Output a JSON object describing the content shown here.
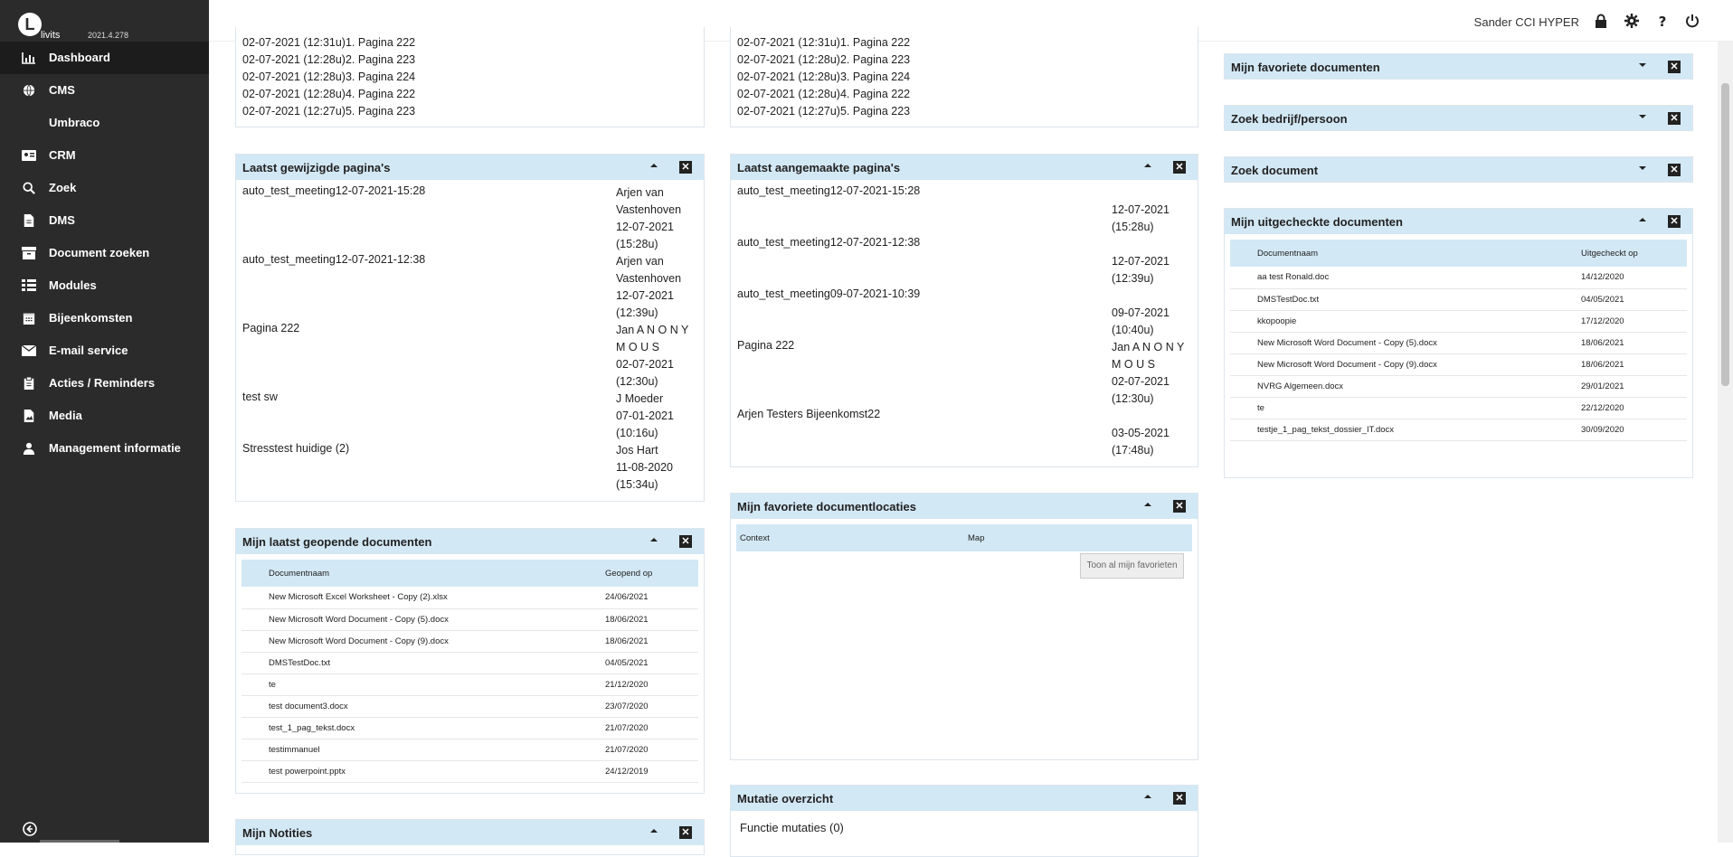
{
  "app": {
    "logo_letter": "L",
    "logo_name": "livits",
    "version": "2021.4.278"
  },
  "nav": [
    {
      "label": "Dashboard"
    },
    {
      "label": "CMS"
    },
    {
      "label": "Umbraco"
    },
    {
      "label": "CRM"
    },
    {
      "label": "Zoek"
    },
    {
      "label": "DMS"
    },
    {
      "label": "Document zoeken"
    },
    {
      "label": "Modules"
    },
    {
      "label": "Bijeenkomsten"
    },
    {
      "label": "E-mail service"
    },
    {
      "label": "Acties / Reminders"
    },
    {
      "label": "Media"
    },
    {
      "label": "Management informatie"
    }
  ],
  "header": {
    "user": "Sander CCI HYPER"
  },
  "recent_visited_1": [
    "02-07-2021 (12:31u)1. Pagina 222",
    "02-07-2021 (12:28u)2. Pagina 223",
    "02-07-2021 (12:28u)3. Pagina 224",
    "02-07-2021 (12:28u)4. Pagina 222",
    "02-07-2021 (12:27u)5. Pagina 223"
  ],
  "recent_visited_2": [
    "02-07-2021 (12:31u)1. Pagina 222",
    "02-07-2021 (12:28u)2. Pagina 223",
    "02-07-2021 (12:28u)3. Pagina 224",
    "02-07-2021 (12:28u)4. Pagina 222",
    "02-07-2021 (12:27u)5. Pagina 223"
  ],
  "changed_pages": {
    "title": "Laatst gewijzigde pagina's",
    "rows": [
      {
        "name": "auto_test_meeting12-07-2021-15:28",
        "meta": [
          "Arjen van",
          "Vastenhoven",
          "12-07-2021",
          "(15:28u)"
        ]
      },
      {
        "name": "auto_test_meeting12-07-2021-12:38",
        "meta": [
          "Arjen van",
          "Vastenhoven",
          "12-07-2021",
          "(12:39u)"
        ]
      },
      {
        "name": "Pagina 222",
        "meta": [
          "Jan A N O N Y",
          "M O U S",
          "02-07-2021",
          "(12:30u)"
        ]
      },
      {
        "name": "test sw",
        "meta": [
          "J Moeder",
          "07-01-2021",
          "(10:16u)"
        ]
      },
      {
        "name": "Stresstest huidige (2)",
        "meta": [
          "Jos Hart",
          "11-08-2020",
          "(15:34u)"
        ]
      }
    ]
  },
  "created_pages": {
    "title": "Laatst aangemaakte pagina's",
    "rows": [
      {
        "name": "auto_test_meeting12-07-2021-15:28",
        "meta": [
          "",
          "12-07-2021",
          "(15:28u)"
        ]
      },
      {
        "name": "auto_test_meeting12-07-2021-12:38",
        "meta": [
          "",
          "12-07-2021",
          "(12:39u)"
        ]
      },
      {
        "name": "auto_test_meeting09-07-2021-10:39",
        "meta": [
          "",
          "09-07-2021",
          "(10:40u)"
        ]
      },
      {
        "name": "Pagina 222",
        "meta": [
          "Jan A N O N Y",
          "M O U S",
          "02-07-2021",
          "(12:30u)"
        ]
      },
      {
        "name": "Arjen Testers Bijeenkomst22",
        "meta": [
          "",
          "03-05-2021",
          "(17:48u)"
        ]
      }
    ]
  },
  "opened_docs": {
    "title": "Mijn laatst geopende documenten",
    "columns": [
      "Documentnaam",
      "Geopend op"
    ],
    "rows": [
      [
        "New Microsoft Excel Worksheet - Copy (2).xlsx",
        "24/06/2021"
      ],
      [
        "New Microsoft Word Document - Copy (5).docx",
        "18/06/2021"
      ],
      [
        "New Microsoft Word Document - Copy (9).docx",
        "18/06/2021"
      ],
      [
        "DMSTestDoc.txt",
        "04/05/2021"
      ],
      [
        "te",
        "21/12/2020"
      ],
      [
        "test document3.docx",
        "23/07/2020"
      ],
      [
        "test_1_pag_tekst.docx",
        "21/07/2020"
      ],
      [
        "testimmanuel",
        "21/07/2020"
      ],
      [
        "test powerpoint.pptx",
        "24/12/2019"
      ]
    ]
  },
  "fav_locations": {
    "title": "Mijn favoriete documentlocaties",
    "columns": [
      "Context",
      "Map"
    ],
    "button": "Toon al mijn favorieten"
  },
  "mutations": {
    "title": "Mutatie overzicht",
    "line": "Functie mutaties (0)"
  },
  "notes": {
    "title": "Mijn Notities"
  },
  "fav_docs": {
    "title": "Mijn favoriete documenten"
  },
  "search_company": {
    "title": "Zoek bedrijf/persoon"
  },
  "search_doc": {
    "title": "Zoek document"
  },
  "checked_out": {
    "title": "Mijn uitgecheckte documenten",
    "columns": [
      "Documentnaam",
      "Uitgecheckt op"
    ],
    "rows": [
      [
        "aa test Ronald.doc",
        "14/12/2020"
      ],
      [
        "DMSTestDoc.txt",
        "04/05/2021"
      ],
      [
        "kkopoopie",
        "17/12/2020"
      ],
      [
        "New Microsoft Word Document - Copy (5).docx",
        "18/06/2021"
      ],
      [
        "New Microsoft Word Document - Copy (9).docx",
        "18/06/2021"
      ],
      [
        "NVRG Algemeen.docx",
        "29/01/2021"
      ],
      [
        "te",
        "22/12/2020"
      ],
      [
        "testje_1_pag_tekst_dossier_IT.docx",
        "30/09/2020"
      ]
    ]
  },
  "icons": {
    "collapse": "caret-up-icon",
    "expand": "caret-down-icon",
    "close": "close-box-icon"
  }
}
